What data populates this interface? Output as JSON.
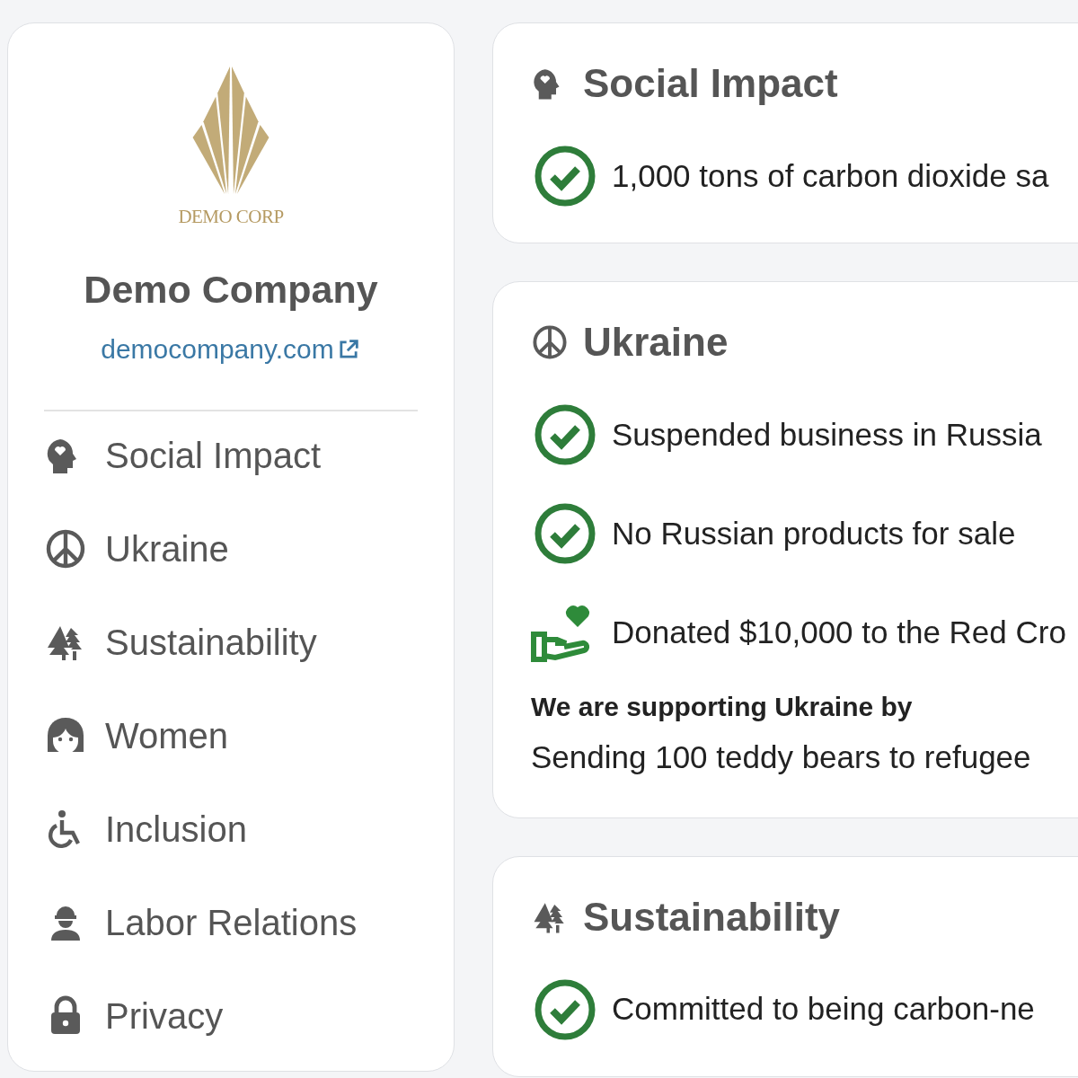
{
  "company": {
    "logo_text": "DEMO CORP",
    "name": "Demo Company",
    "website": "democompany.com"
  },
  "nav": [
    {
      "label": "Social Impact",
      "kind": "head"
    },
    {
      "label": "Ukraine",
      "kind": "peace"
    },
    {
      "label": "Sustainability",
      "kind": "trees"
    },
    {
      "label": "Women",
      "kind": "woman"
    },
    {
      "label": "Inclusion",
      "kind": "wheelchair"
    },
    {
      "label": "Labor Relations",
      "kind": "worker"
    },
    {
      "label": "Privacy",
      "kind": "lock"
    }
  ],
  "sections": [
    {
      "title": "Social Impact",
      "kind": "head",
      "items": [
        {
          "kind": "check",
          "text": "1,000 tons of carbon dioxide sa"
        }
      ]
    },
    {
      "title": "Ukraine",
      "kind": "peace",
      "items": [
        {
          "kind": "check",
          "text": "Suspended business in Russia"
        },
        {
          "kind": "check",
          "text": "No Russian products for sale"
        },
        {
          "kind": "donation",
          "text": "Donated $10,000 to the Red Cro"
        }
      ],
      "support": {
        "heading": "We are supporting Ukraine by",
        "text": "Sending 100 teddy bears to refugee"
      }
    },
    {
      "title": "Sustainability",
      "kind": "trees",
      "items": [
        {
          "kind": "check",
          "text": "Committed to being carbon-ne"
        }
      ]
    }
  ]
}
